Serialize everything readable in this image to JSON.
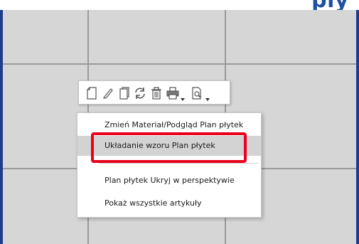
{
  "header": {
    "title_fragment": "ply"
  },
  "toolbar": {
    "buttons": [
      {
        "icon": "new-page-icon"
      },
      {
        "icon": "pencil-icon"
      },
      {
        "icon": "copy-page-icon"
      },
      {
        "icon": "rotate-icon"
      },
      {
        "icon": "trash-icon"
      },
      {
        "icon": "printer-icon",
        "has_dropdown": true
      },
      {
        "icon": "preview-zoom-icon",
        "has_dropdown": true
      }
    ]
  },
  "context_menu": {
    "items": [
      {
        "label": "Zmień Materiał/Podgląd Plan płytek"
      },
      {
        "label": "Układanie wzoru Plan płytek",
        "highlighted": true
      },
      {
        "label": "Plan płytek Ukryj w perspektywie"
      },
      {
        "label": "Pokaż wszystkie artykuły"
      }
    ]
  },
  "colors": {
    "annotation_red": "#e8001c",
    "frame_blue": "#1f3d8c",
    "tile_grey": "#d6d6d6",
    "grout": "#9a9a9a",
    "hover_grey": "#d3d3d3"
  }
}
